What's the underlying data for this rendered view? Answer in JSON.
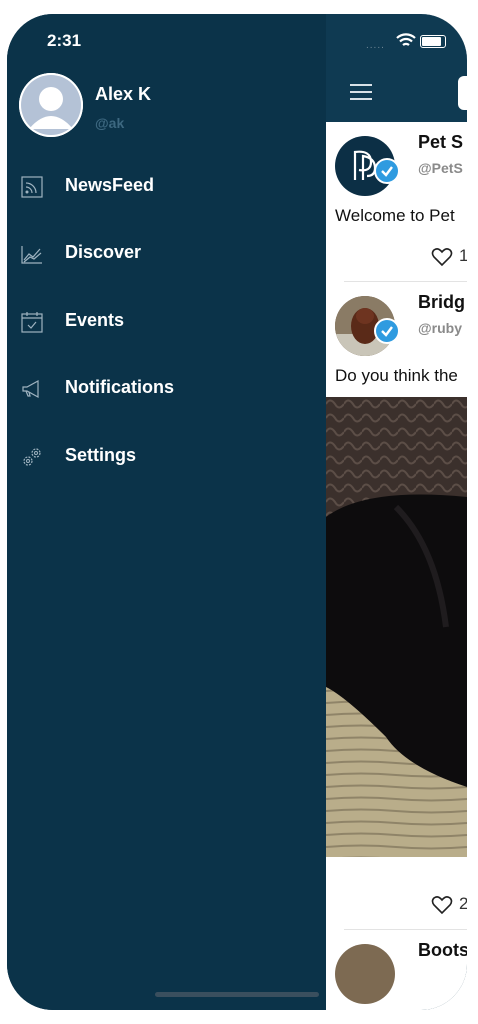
{
  "status_bar": {
    "time": "2:31",
    "signal": "....."
  },
  "user": {
    "name": "Alex K",
    "handle": "@ak"
  },
  "menu": [
    {
      "label": "NewsFeed",
      "icon": "rss-icon"
    },
    {
      "label": "Discover",
      "icon": "chart-icon"
    },
    {
      "label": "Events",
      "icon": "calendar-icon"
    },
    {
      "label": "Notifications",
      "icon": "megaphone-icon"
    },
    {
      "label": "Settings",
      "icon": "gears-icon"
    }
  ],
  "feed": {
    "posts": [
      {
        "name": "Pet S",
        "handle": "@PetS",
        "text": "Welcome to Pet",
        "likes": "1"
      },
      {
        "name": "Bridg",
        "handle": "@ruby",
        "text": "Do you think the",
        "likes": "2"
      },
      {
        "name": "Boots"
      }
    ]
  },
  "colors": {
    "drawer_bg": "#0b3349",
    "header_bg": "#0f3a52",
    "verified": "#2f9be0"
  }
}
